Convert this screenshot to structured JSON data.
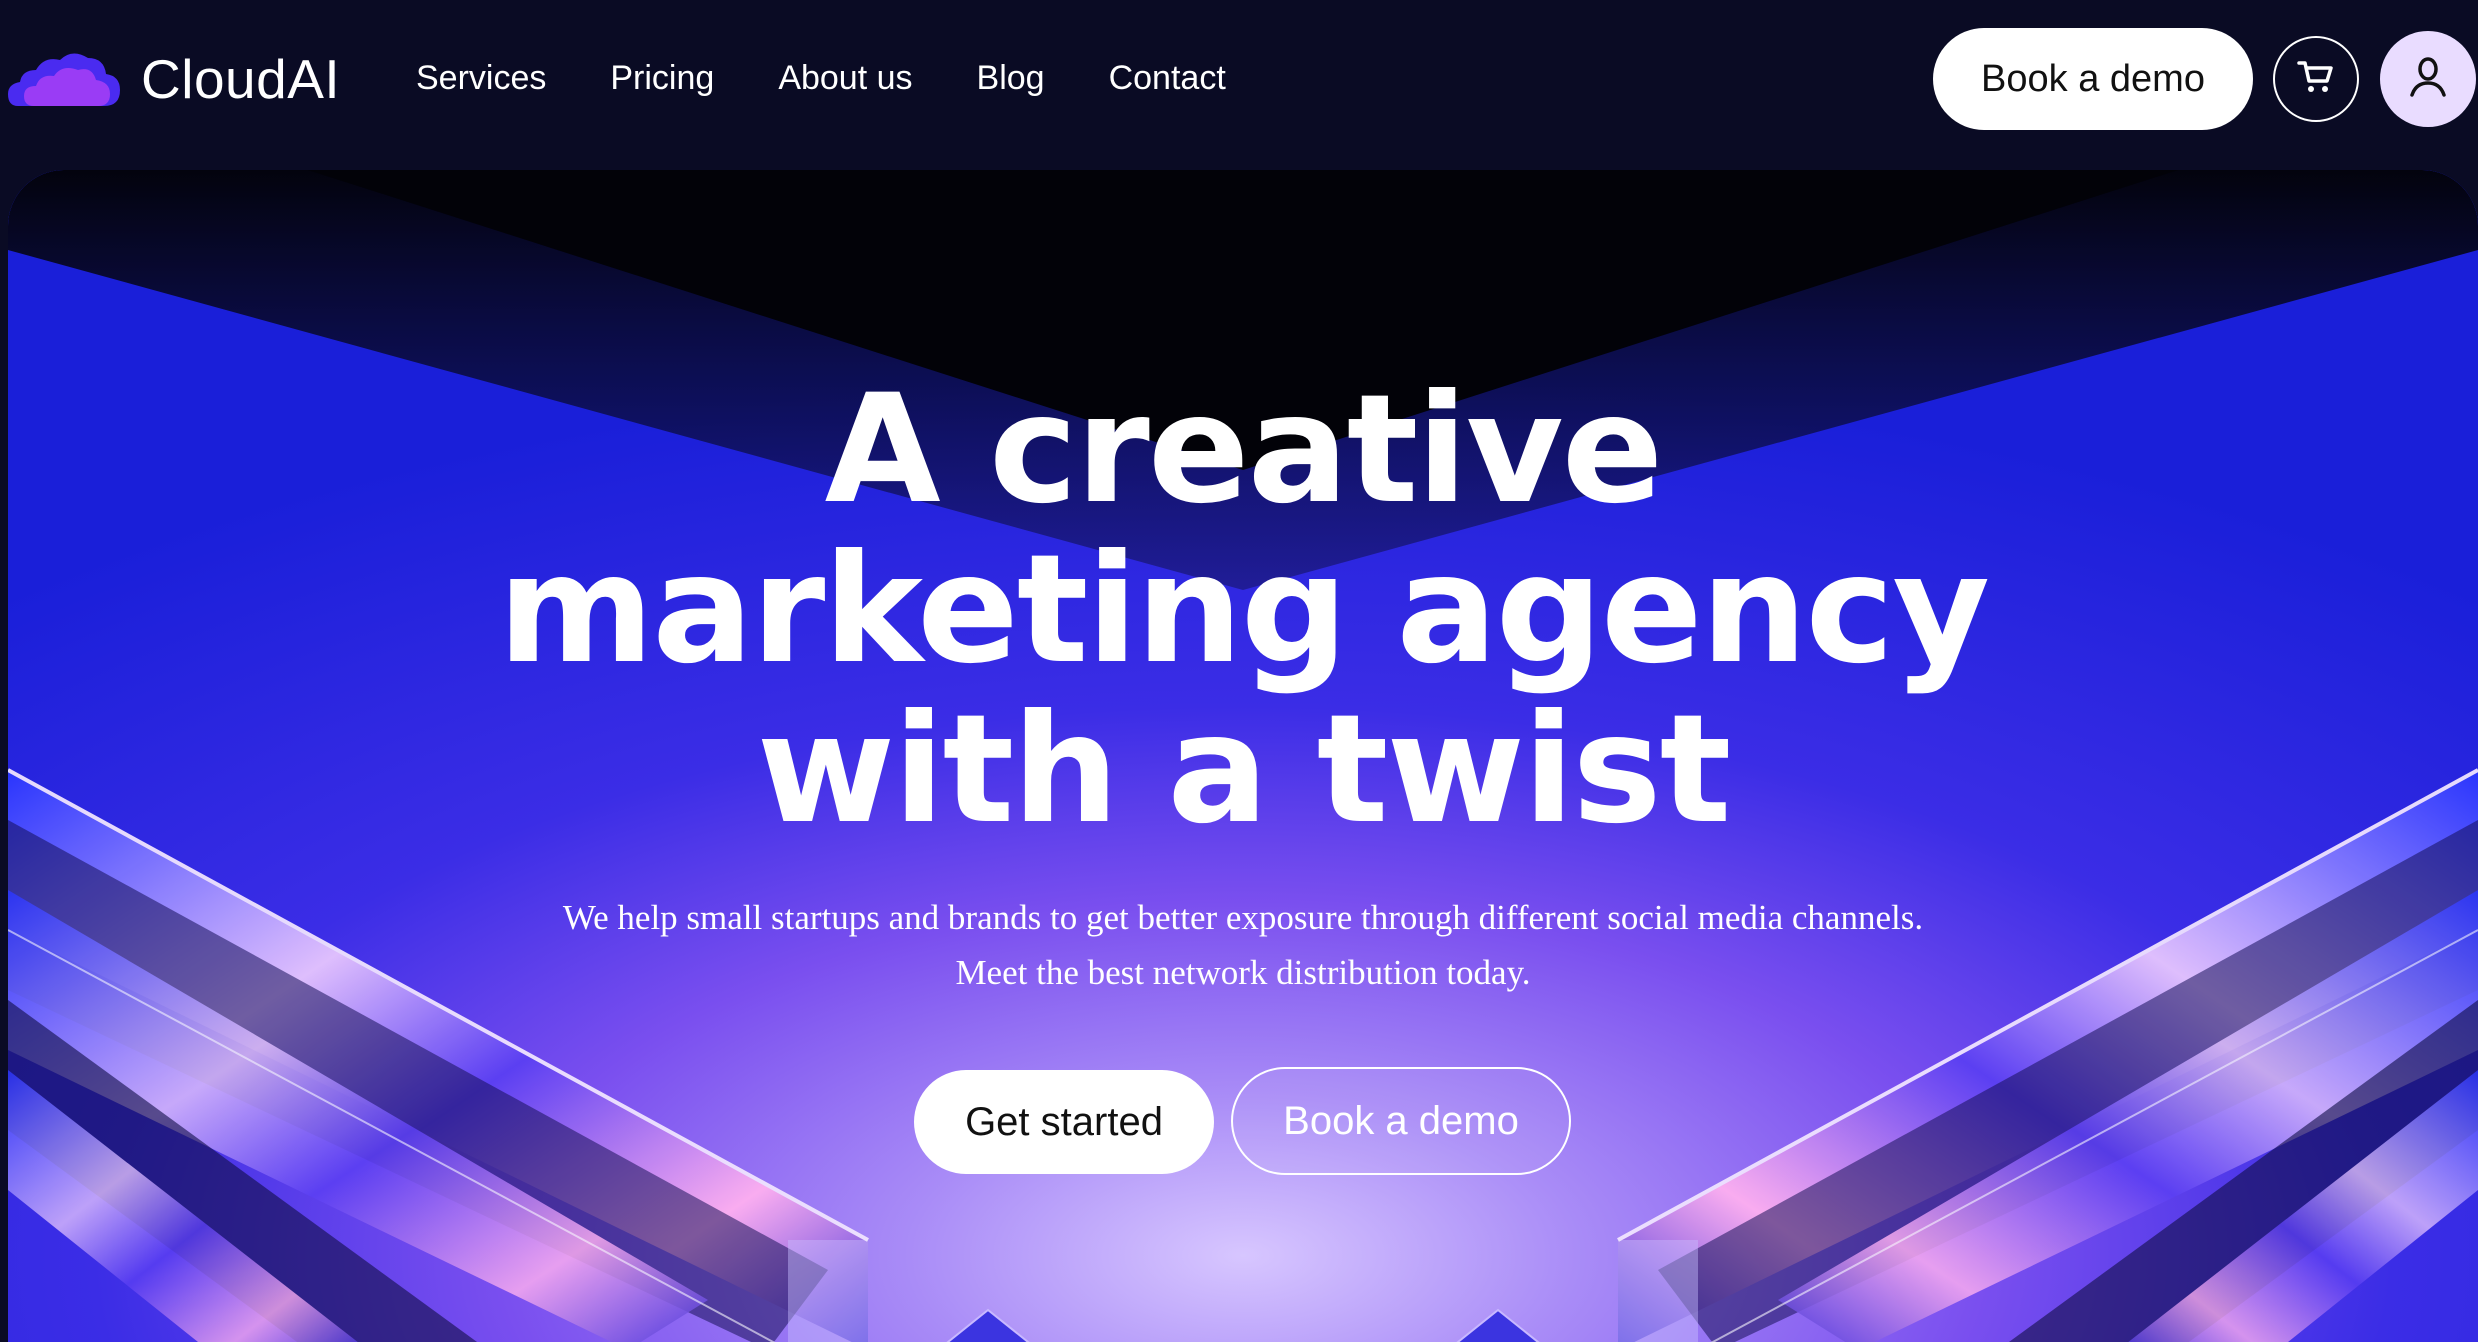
{
  "brand": {
    "name": "CloudAI",
    "logo_icon": "cloud-icon"
  },
  "nav": {
    "links": [
      "Services",
      "Pricing",
      "About us",
      "Blog",
      "Contact"
    ],
    "cta_label": "Book a demo",
    "cart_icon": "cart-icon",
    "user_icon": "user-icon"
  },
  "hero": {
    "title_lines": [
      "A creative",
      "marketing agency",
      "with a twist"
    ],
    "subtitle_lines": [
      "We help small startups and brands to get better exposure through different social media channels.",
      "Meet the best network distribution today."
    ],
    "primary_button": "Get started",
    "secondary_button": "Book a demo"
  },
  "colors": {
    "nav_bg": "#0a0b24",
    "hero_blue": "#1a1fd9",
    "hero_violet": "#8d5cf0",
    "logo_purple": "#7b2cf0",
    "button_bg": "#ffffff",
    "user_avatar_bg": "#e9dcff"
  }
}
